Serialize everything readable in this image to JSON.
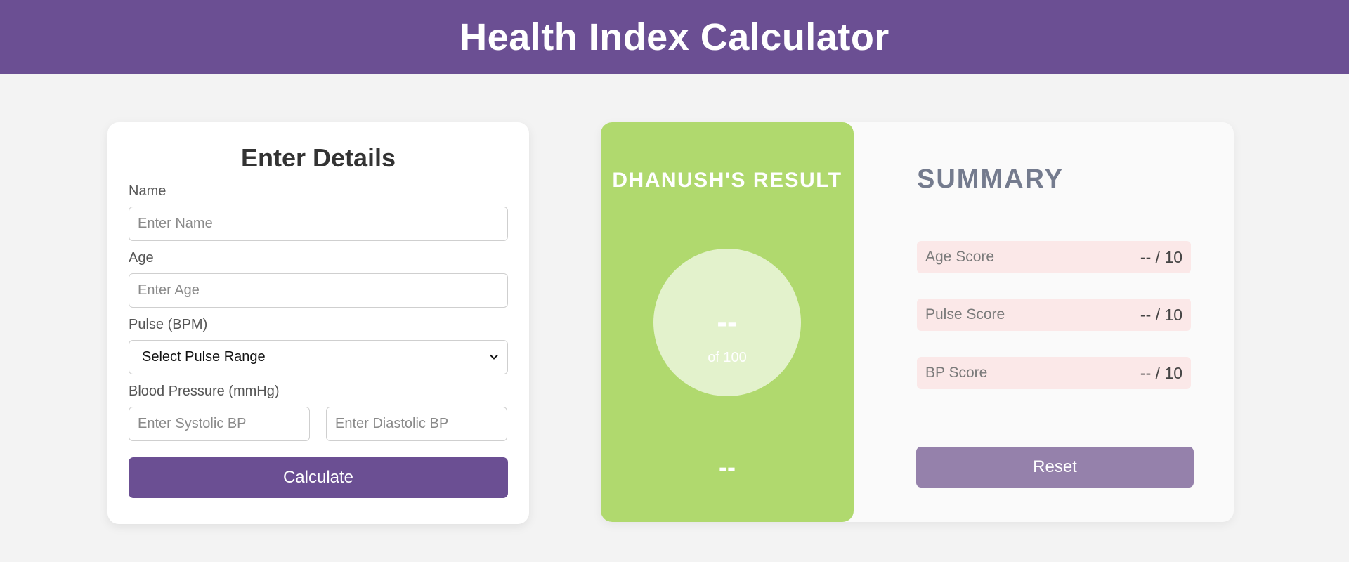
{
  "header": {
    "title": "Health Index Calculator"
  },
  "form": {
    "title": "Enter Details",
    "name_label": "Name",
    "name_placeholder": "Enter Name",
    "age_label": "Age",
    "age_placeholder": "Enter Age",
    "pulse_label": "Pulse (BPM)",
    "pulse_selected": "Select Pulse Range",
    "bp_label": "Blood Pressure (mmHg)",
    "systolic_placeholder": "Enter Systolic BP",
    "diastolic_placeholder": "Enter Diastolic BP",
    "calculate_label": "Calculate"
  },
  "result": {
    "title": "DHANUSH'S RESULT",
    "score": "--",
    "score_of": "of 100",
    "status": "--",
    "panel_color": "#b0d96e"
  },
  "summary": {
    "title": "SUMMARY",
    "rows": [
      {
        "label": "Age Score",
        "value": "-- / 10"
      },
      {
        "label": "Pulse Score",
        "value": "-- / 10"
      },
      {
        "label": "BP Score",
        "value": "-- / 10"
      }
    ],
    "reset_label": "Reset"
  },
  "colors": {
    "brand": "#6b4f93",
    "reset": "#9581ab",
    "score_row_bg": "#fbe8e8"
  },
  "icons": {
    "select_arrow": "chevron-down-icon"
  }
}
